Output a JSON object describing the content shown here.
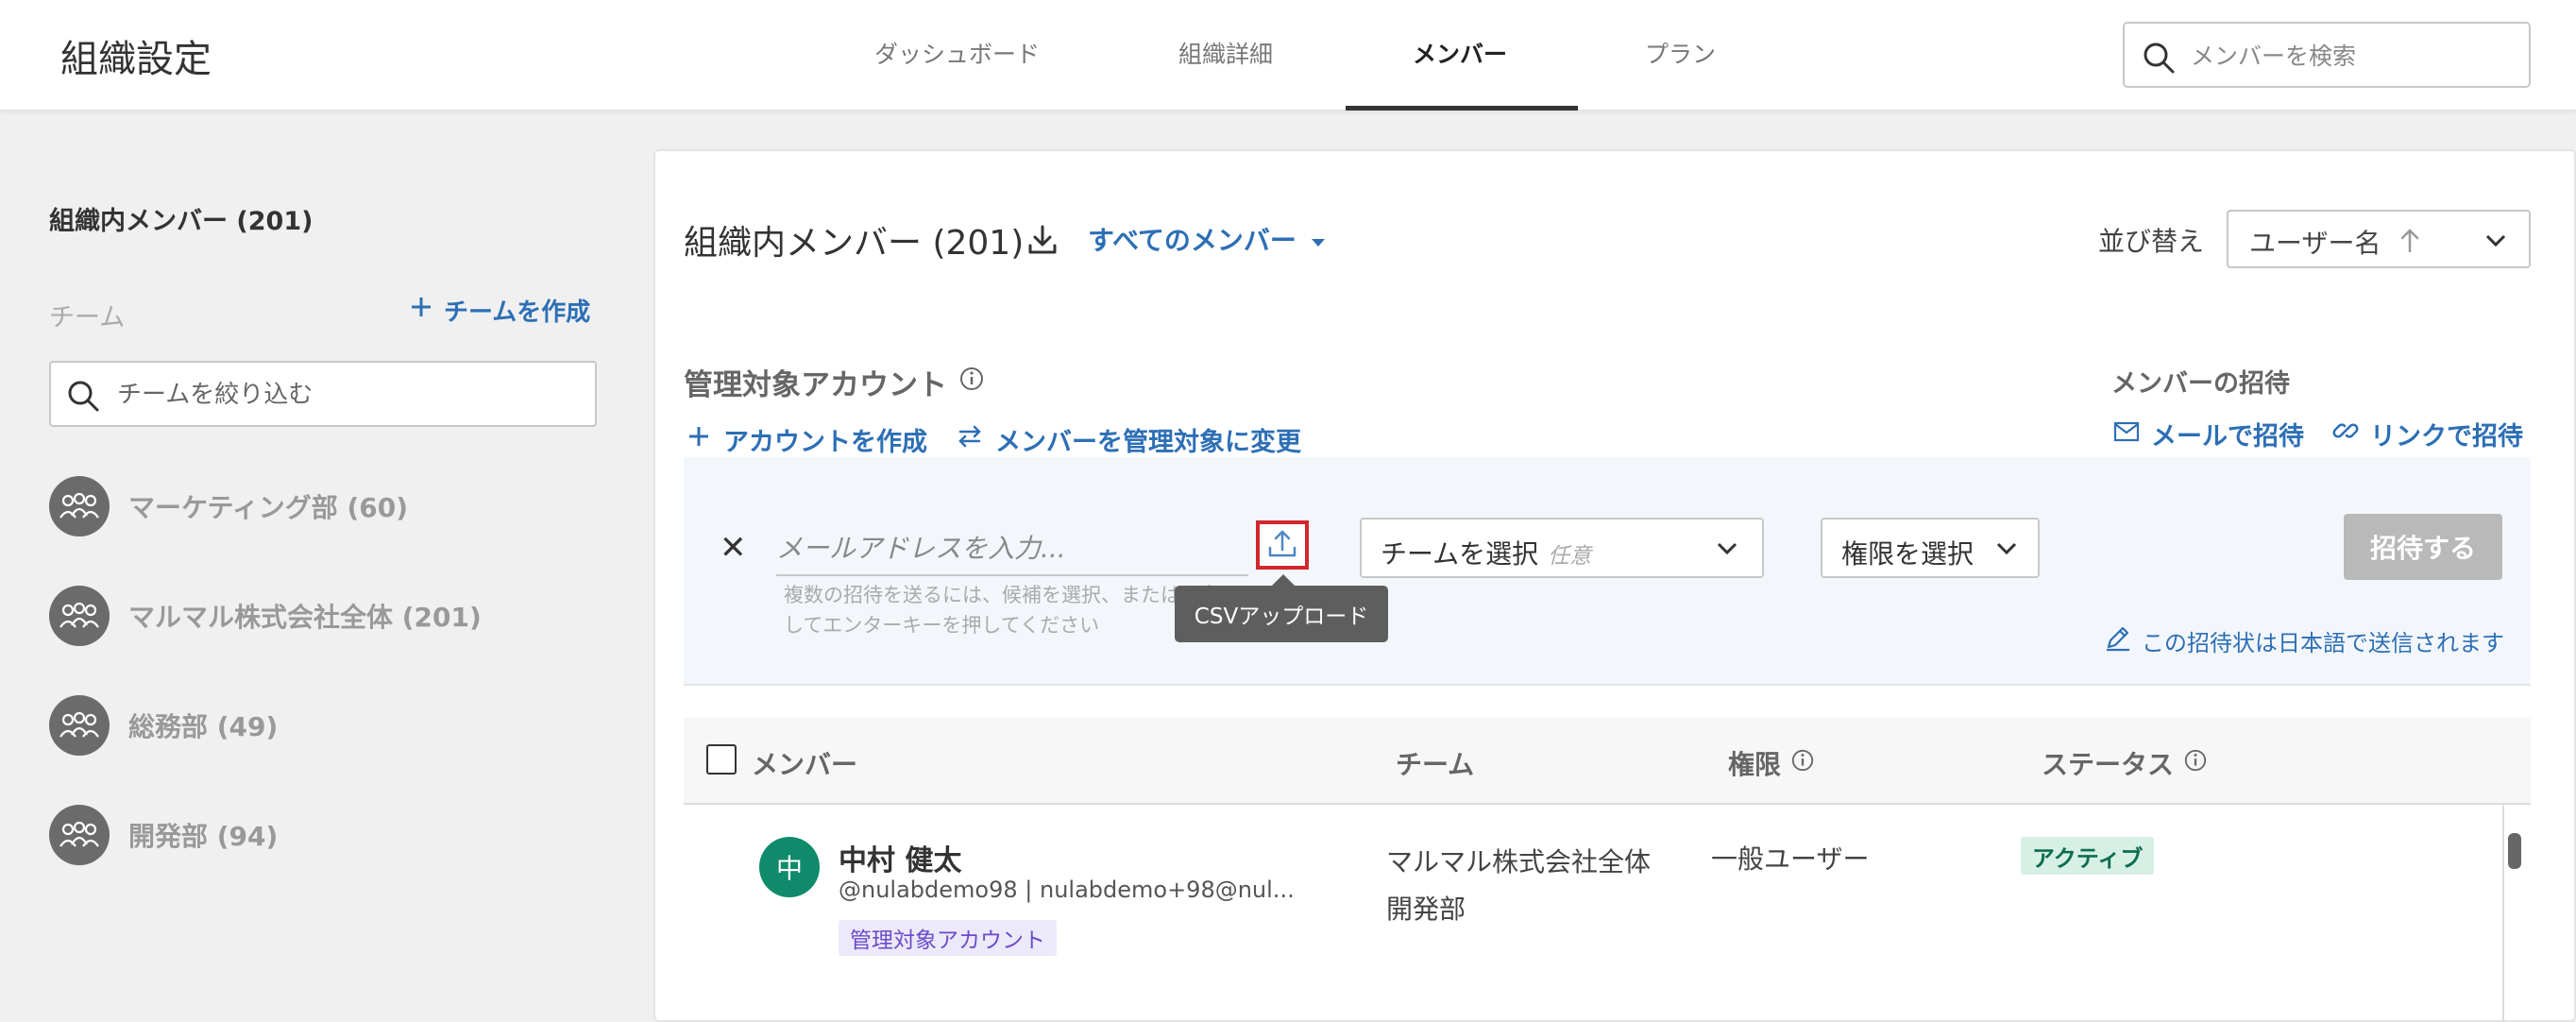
{
  "header": {
    "title": "組織設定",
    "tabs": [
      {
        "label": "ダッシュボード"
      },
      {
        "label": "組織詳細"
      },
      {
        "label": "メンバー"
      },
      {
        "label": "プラン"
      }
    ],
    "search_placeholder": "メンバーを検索"
  },
  "sidebar": {
    "title": "組織内メンバー (201)",
    "teams_label": "チーム",
    "create_team": "チームを作成",
    "filter_placeholder": "チームを絞り込む",
    "teams": [
      {
        "name": "マーケティング部 (60)"
      },
      {
        "name": "マルマル株式会社全体 (201)"
      },
      {
        "name": "総務部 (49)"
      },
      {
        "name": "開発部 (94)"
      }
    ]
  },
  "main": {
    "title": "組織内メンバー (201)",
    "filter_label": "すべてのメンバー",
    "sort_label": "並び替え",
    "sort_value": "ユーザー名",
    "managed": {
      "title": "管理対象アカウント",
      "create_account": "アカウントを作成",
      "convert_members": "メンバーを管理対象に変更"
    },
    "invite": {
      "title": "メンバーの招待",
      "by_email": "メールで招待",
      "by_link": "リンクで招待"
    },
    "invite_panel": {
      "email_placeholder": "メールアドレスを入力...",
      "helper_line1": "複数の招待を送るには、候補を選択、または入力",
      "helper_line2": "してエンターキーを押してください",
      "tooltip": "CSVアップロード",
      "team_select": "チームを選択",
      "team_optional": "任意",
      "perm_select": "権限を選択",
      "invite_button": "招待する",
      "language_note": "この招待状は日本語で送信されます"
    },
    "table": {
      "columns": {
        "member": "メンバー",
        "team": "チーム",
        "permission": "権限",
        "status": "ステータス"
      },
      "rows": [
        {
          "avatar": "中",
          "name": "中村 健太",
          "sub": "@nulabdemo98 | nulabdemo+98@nul...",
          "badge": "管理対象アカウント",
          "team1": "マルマル株式会社全体",
          "team2": "開発部",
          "permission": "一般ユーザー",
          "status": "アクティブ"
        }
      ]
    }
  },
  "colors": {
    "accent": "#2d6fb5",
    "highlight": "#d0282d",
    "status_active": "#0e6d4f",
    "avatar": "#0f8a6a"
  }
}
